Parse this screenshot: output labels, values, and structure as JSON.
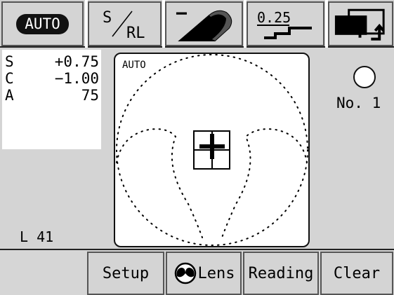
{
  "toolbar": {
    "auto_label": "AUTO",
    "s_label": "S",
    "rl_label": "RL",
    "minus_label": "−",
    "step_label": "0.25"
  },
  "readings": {
    "rows": [
      {
        "label": "S",
        "value": "+0.75"
      },
      {
        "label": "C",
        "value": "−1.00"
      },
      {
        "label": "A",
        "value": "75"
      }
    ],
    "l_value": "L 41"
  },
  "view": {
    "mode_label": "AUTO"
  },
  "status": {
    "lens_number": "No. 1"
  },
  "bottombar": {
    "setup_label": "Setup",
    "lens_label": "Lens",
    "reading_label": "Reading",
    "clear_label": "Clear"
  }
}
